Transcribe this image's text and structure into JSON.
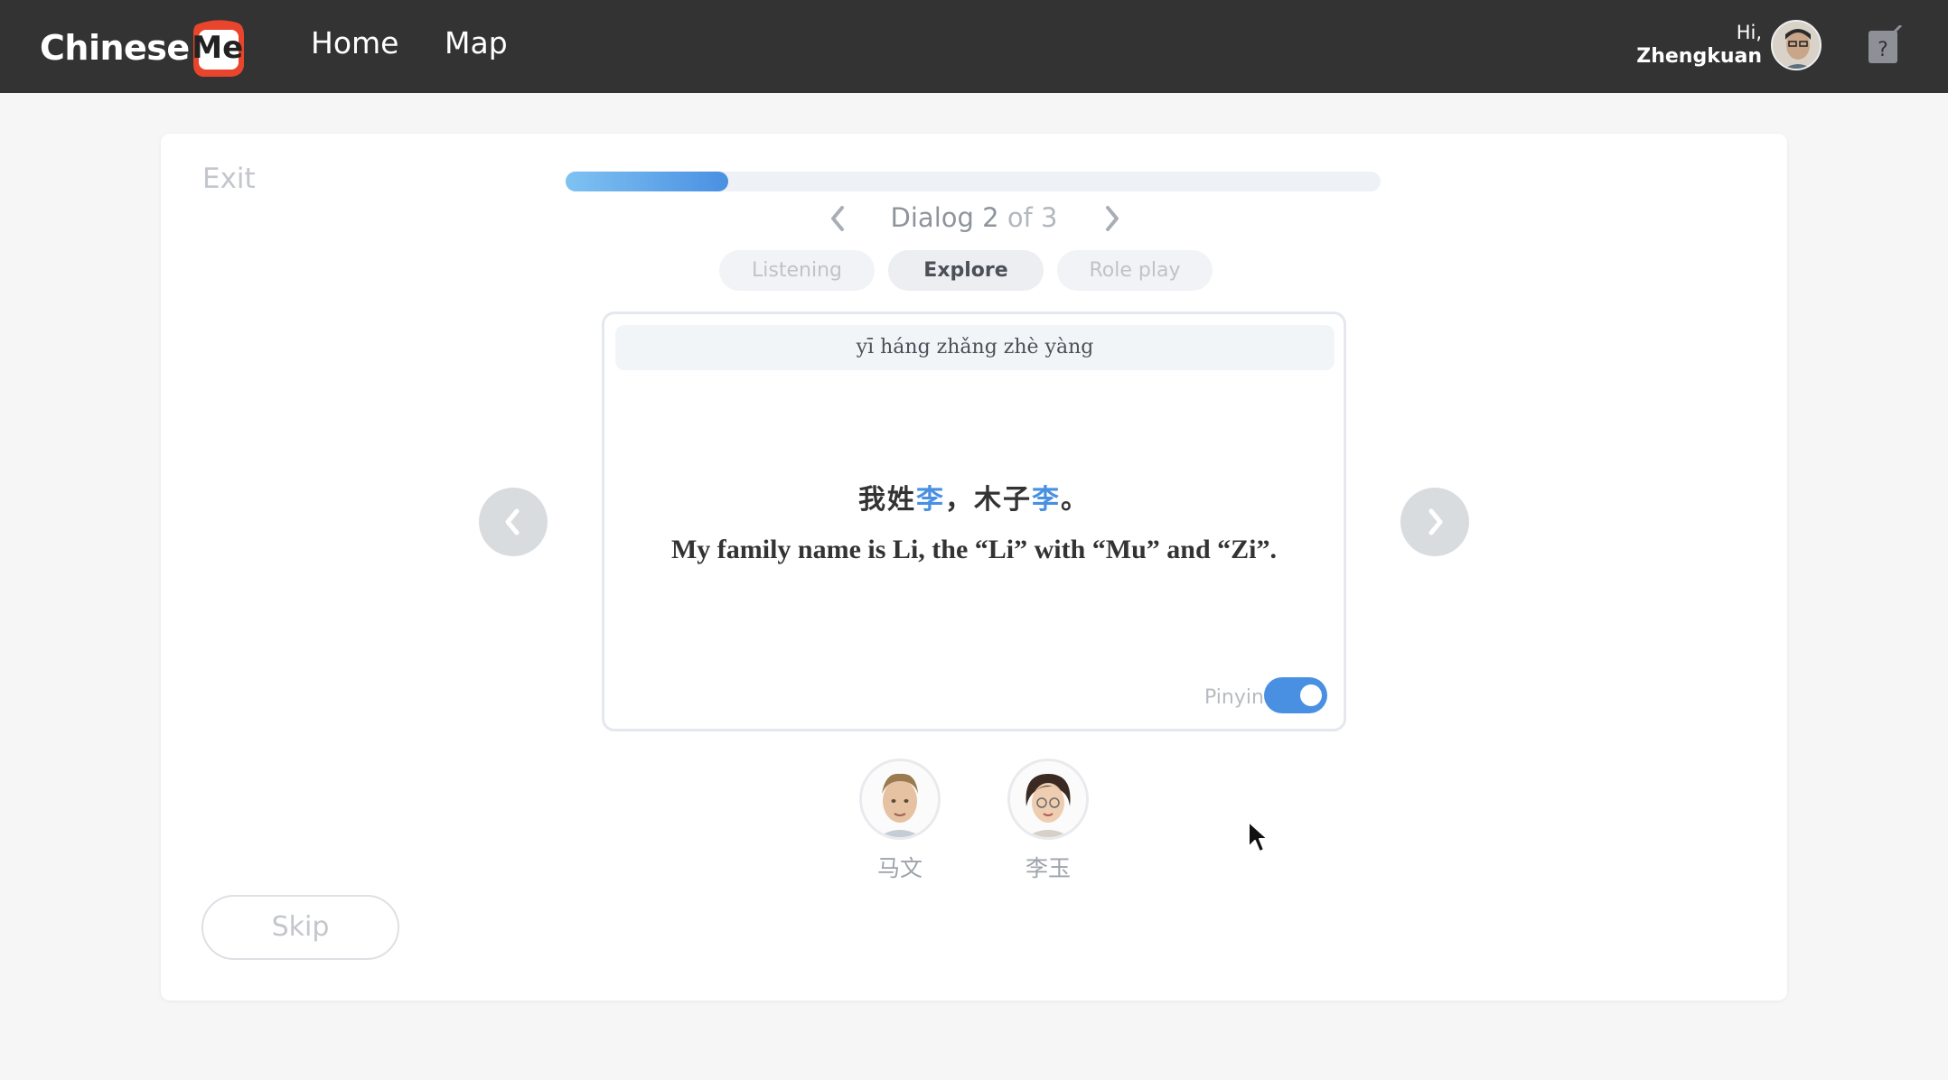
{
  "header": {
    "logo_text": "Chinese",
    "logo_badge": "Me",
    "nav": [
      {
        "label": "Home"
      },
      {
        "label": "Map"
      }
    ],
    "greeting": "Hi,",
    "user_name": "Zhengkuan",
    "help_icon": "help-notepad-icon"
  },
  "lesson": {
    "exit_label": "Exit",
    "progress_fraction": 0.2,
    "dialog_label": "Dialog 2",
    "dialog_of": "of 3",
    "tabs": [
      {
        "label": "Listening",
        "active": false
      },
      {
        "label": "Explore",
        "active": true
      },
      {
        "label": "Role play",
        "active": false
      }
    ],
    "pinyin_line": "yī háng zhǎng zhè yàng",
    "hanzi_parts": [
      {
        "text": "我姓",
        "highlight": false
      },
      {
        "text": "李",
        "highlight": true
      },
      {
        "text": "，木子",
        "highlight": false
      },
      {
        "text": "李",
        "highlight": true
      },
      {
        "text": "。",
        "highlight": false
      }
    ],
    "english": "My family name is Li, the “Li” with “Mu” and “Zi”.",
    "pinyin_toggle_label": "Pinyin",
    "pinyin_toggle_on": true,
    "speakers": [
      {
        "name": "马文"
      },
      {
        "name": "李玉"
      }
    ],
    "skip_label": "Skip"
  },
  "colors": {
    "topbar": "#333333",
    "accent": "#4a90e2",
    "logo_red": "#e8452c"
  }
}
